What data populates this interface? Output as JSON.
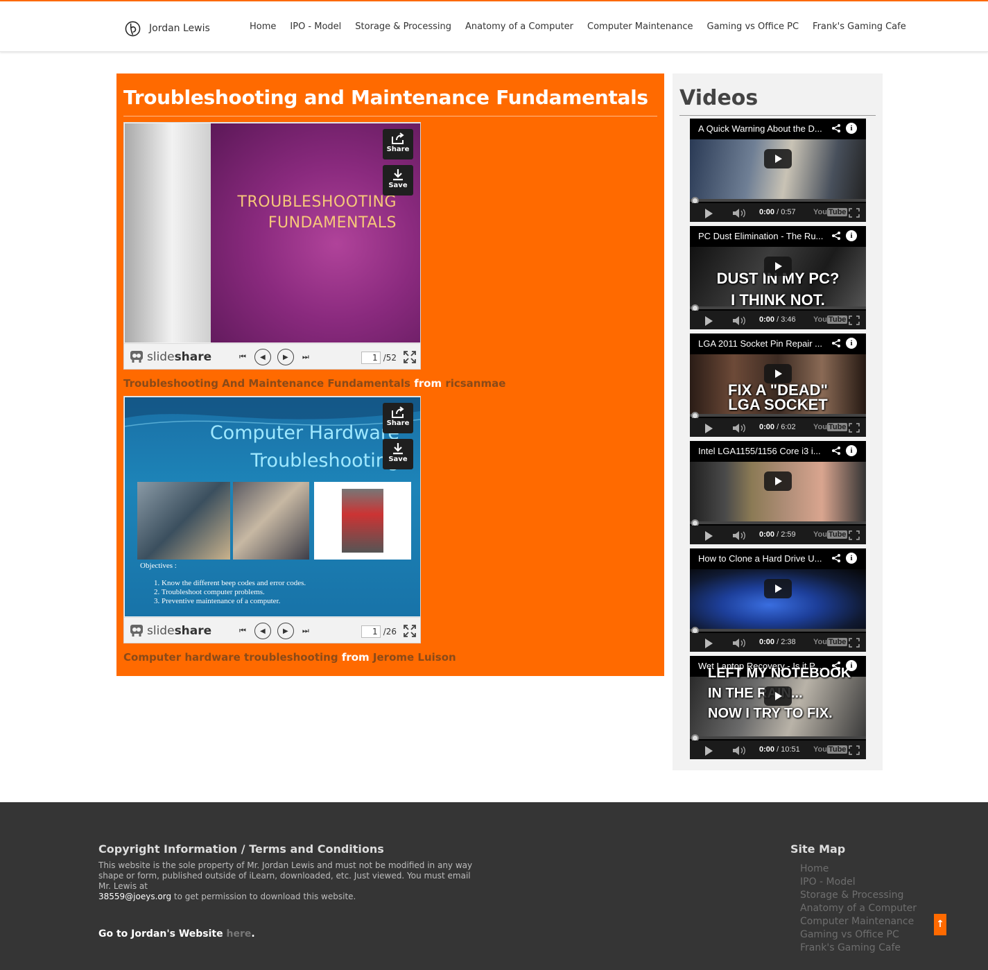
{
  "header": {
    "brand_name": "Jordan Lewis",
    "accent_color": "#ff6a00",
    "nav": [
      "Home",
      "IPO - Model",
      "Storage & Processing",
      "Anatomy of a Computer",
      "Computer Maintenance",
      "Gaming vs Office PC",
      "Frank's Gaming Cafe"
    ]
  },
  "main": {
    "title": "Troubleshooting and Maintenance Fundamentals",
    "decks": [
      {
        "slide_title_line1": "TROUBLESHOOTING",
        "slide_title_line2": "FUNDAMENTALS",
        "share_label": "Share",
        "save_label": "Save",
        "logo_text": "slide",
        "logo_text_bold": "share",
        "page_current": "1",
        "page_total": "/52",
        "caption_link": "Troubleshooting And Maintenance Fundamentals",
        "caption_from": "from",
        "caption_author": "ricsanmae"
      },
      {
        "slide_title_line1": "Computer Hardware",
        "slide_title_line2": "Troubleshooting",
        "objectives_label": "Objectives :",
        "objectives": [
          "Know the different beep codes and error codes.",
          "Troubleshoot computer problems.",
          "Preventive maintenance of a computer."
        ],
        "share_label": "Share",
        "save_label": "Save",
        "logo_text": "slide",
        "logo_text_bold": "share",
        "page_current": "1",
        "page_total": "/26",
        "caption_link": "Computer hardware troubleshooting",
        "caption_from": "from",
        "caption_author": "Jerome Luison"
      }
    ]
  },
  "sidebar": {
    "title": "Videos",
    "videos": [
      {
        "title": "A Quick Warning About the D...",
        "time_current": "0:00",
        "time_total": "/ 0:57",
        "overlay1": "",
        "overlay2": ""
      },
      {
        "title": "PC Dust Elimination - The Ru...",
        "time_current": "0:00",
        "time_total": "/ 3:46",
        "overlay1": "DUST IN MY PC?",
        "overlay2": "I THINK NOT."
      },
      {
        "title": "LGA 2011 Socket Pin Repair ...",
        "time_current": "0:00",
        "time_total": "/ 6:02",
        "overlay1": "FIX A \"DEAD\"",
        "overlay2": "LGA SOCKET"
      },
      {
        "title": "Intel LGA1155/1156 Core i3 i...",
        "time_current": "0:00",
        "time_total": "/ 2:59",
        "overlay1": "",
        "overlay2": ""
      },
      {
        "title": "How to Clone a Hard Drive U...",
        "time_current": "0:00",
        "time_total": "/ 2:38",
        "overlay1": "",
        "overlay2": ""
      },
      {
        "title": "Wet Laptop Recovery - Is it P...",
        "time_current": "0:00",
        "time_total": "/ 10:51",
        "overlay1": "LEFT MY NOTEBOOK",
        "overlay2": "IN THE RAIN...",
        "overlay3": "NOW I TRY TO FIX."
      }
    ],
    "youtube_label": "You",
    "youtube_label_box": "Tube"
  },
  "footer": {
    "copyright_title": "Copyright Information / Terms and Conditions",
    "copyright_text": "This website is the sole property of Mr. Jordan Lewis and must not be modified in any way shape or form, published outside of iLearn, downloaded, etc. Just viewed. You must email Mr. Lewis at",
    "email": "38559@joeys.org",
    "copyright_text_end": "to get permission to download this website.",
    "go_text": "Go to Jordan's Website",
    "go_link": "here",
    "go_period": ".",
    "sitemap_title": "Site Map",
    "sitemap": [
      "Home",
      "IPO - Model",
      "Storage & Processing",
      "Anatomy of a Computer",
      "Computer Maintenance",
      "Gaming vs Office PC",
      "Frank's Gaming Cafe"
    ],
    "to_top": "↑"
  }
}
